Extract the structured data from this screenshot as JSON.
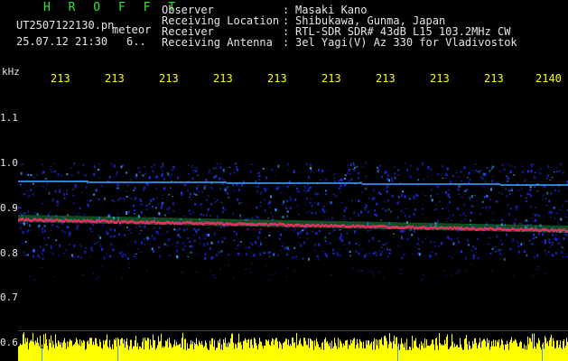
{
  "header": {
    "brand": "H R O F F T",
    "filename": "UT2507122130.pn",
    "tag": "meteor",
    "datetime": "25.07.12 21:30",
    "count": "6.."
  },
  "info": [
    {
      "label": "Observer",
      "value": "Masaki Kano"
    },
    {
      "label": "Receiving Location",
      "value": "Shibukawa, Gunma, Japan"
    },
    {
      "label": "Receiver",
      "value": "RTL-SDR SDR# 43dB L15 103.2MHz CW"
    },
    {
      "label": "Receiving Antenna",
      "value": "3el Yagi(V) Az 330 for Vladivostok"
    }
  ],
  "colon": ":",
  "axis": {
    "unit": "kHz",
    "x_ticks": [
      "213",
      "213",
      "213",
      "213",
      "213",
      "213",
      "213",
      "213",
      "213",
      "2140"
    ],
    "y_ticks": [
      "1.1",
      "1.0",
      "0.9",
      "0.8",
      "0.7",
      "0.6"
    ]
  },
  "colors": {
    "background": "#000000",
    "text_primary": "#e6e6e6",
    "brand": "#2ee82e",
    "axis_ticks": "#ffff00",
    "echo_band": "#ff2a6a",
    "noise": "#1c2cf0",
    "noise_bright": "#3aa0ff",
    "signal_green": "#22e05a",
    "power_trace": "#ffff00"
  }
}
